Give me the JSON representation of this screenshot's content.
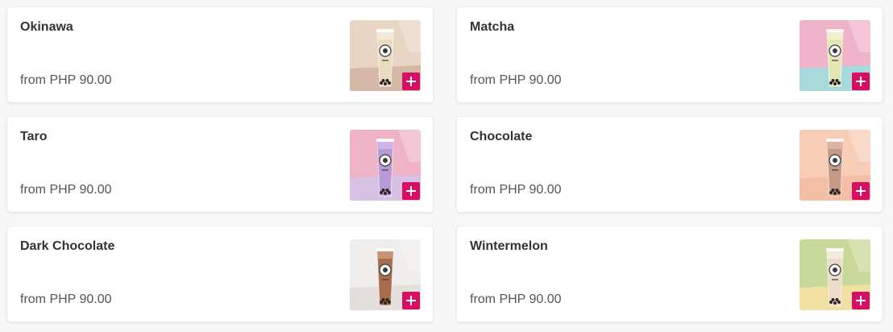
{
  "accent_color": "#d70f64",
  "menu_items": [
    {
      "name": "Okinawa",
      "price": "from PHP 90.00",
      "image": {
        "bg": "#e8d5c3",
        "floor": "#d6b8a6",
        "drink": "#e9dcc0",
        "top": "#f2ead8"
      }
    },
    {
      "name": "Matcha",
      "price": "from PHP 90.00",
      "image": {
        "bg": "#eeb3c8",
        "floor": "#a8d9dc",
        "drink": "#e4e6b5",
        "top": "#eef0cf"
      }
    },
    {
      "name": "Taro",
      "price": "from PHP 90.00",
      "image": {
        "bg": "#efb3c7",
        "floor": "#d7c2e6",
        "drink": "#b79ad6",
        "top": "#cdb6e6"
      }
    },
    {
      "name": "Chocolate",
      "price": "from PHP 90.00",
      "image": {
        "bg": "#f7cdb7",
        "floor": "#f3c0a7",
        "drink": "#c79a86",
        "top": "#d9b4a3"
      }
    },
    {
      "name": "Dark Chocolate",
      "price": "from PHP 90.00",
      "image": {
        "bg": "#efeeec",
        "floor": "#e3e0dc",
        "drink": "#a86d4d",
        "top": "#c59376"
      }
    },
    {
      "name": "Wintermelon",
      "price": "from PHP 90.00",
      "image": {
        "bg": "#c9d99a",
        "floor": "#f2dfa3",
        "drink": "#ecdcc9",
        "top": "#f3ebe0"
      }
    }
  ]
}
